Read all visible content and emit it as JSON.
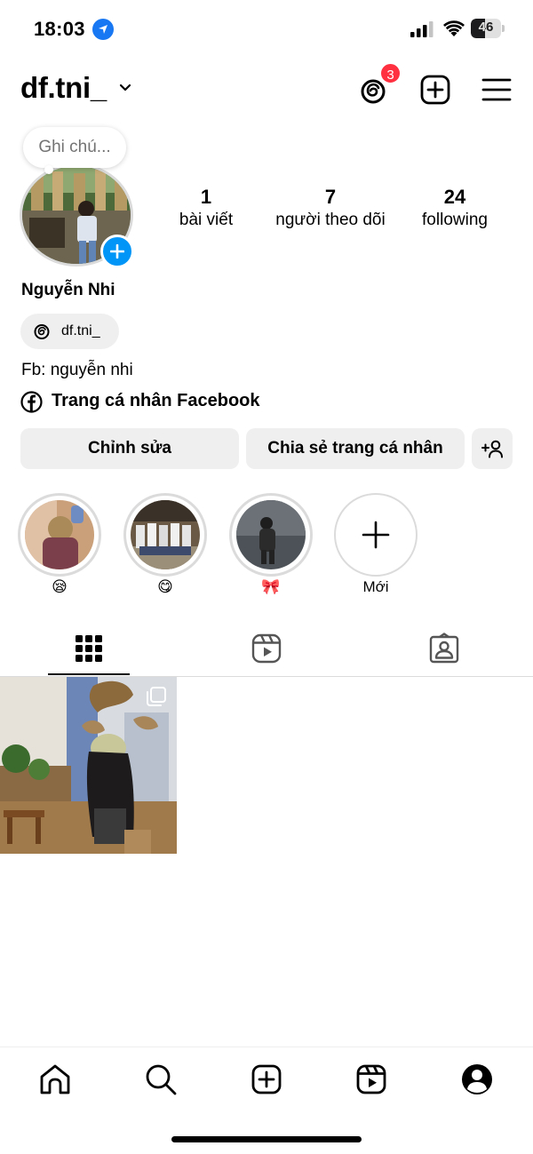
{
  "status_bar": {
    "time": "18:03",
    "battery": "46",
    "battery_level": 0.46,
    "icons": [
      "location-icon",
      "cellular-signal-icon",
      "wifi-icon",
      "battery-icon"
    ]
  },
  "header": {
    "username": "df.tni_",
    "notification_count": "3",
    "icons": [
      "chevron-down-icon",
      "threads-icon",
      "create-icon",
      "menu-icon"
    ]
  },
  "profile": {
    "note_placeholder": "Ghi chú...",
    "full_name": "Nguyễn Nhi",
    "threads_handle": "df.tni_",
    "bio": "Fb: nguyễn nhi",
    "facebook_link": "Trang cá nhân Facebook"
  },
  "stats": {
    "posts_count": "1",
    "posts_label": "bài viết",
    "followers_count": "7",
    "followers_label": "người theo dõi",
    "following_count": "24",
    "following_label": "following"
  },
  "actions": {
    "edit_label": "Chỉnh sửa",
    "share_label": "Chia sẻ trang cá nhân"
  },
  "highlights": [
    {
      "label": "😪"
    },
    {
      "label": "😋"
    },
    {
      "label": "🎀"
    },
    {
      "label": "Mới"
    }
  ],
  "tabs": [
    "grid-icon",
    "reels-icon",
    "tagged-icon"
  ],
  "nav": [
    "home-icon",
    "search-icon",
    "create-icon",
    "reels-icon",
    "profile-icon"
  ],
  "colors": {
    "accent": "#0095f6",
    "badge": "#ff3040",
    "button_bg": "#efefef",
    "ring": "#dbdbdb"
  }
}
